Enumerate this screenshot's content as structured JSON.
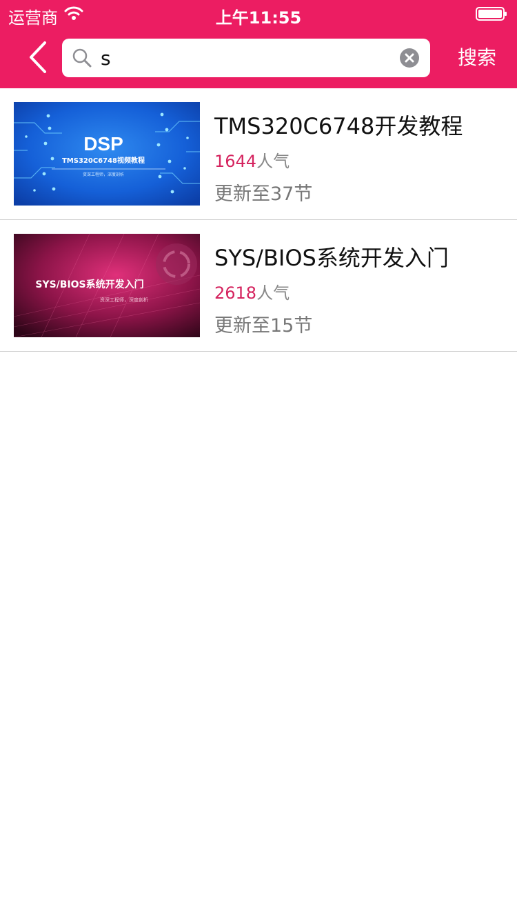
{
  "status_bar": {
    "carrier": "运营商",
    "time": "上午11:55"
  },
  "nav": {
    "search_value": "s",
    "search_button": "搜索"
  },
  "results": [
    {
      "title": "TMS320C6748开发教程",
      "popularity": "1644",
      "popularity_suffix": "人气",
      "update": "更新至37节",
      "thumb": {
        "heading": "DSP",
        "subtitle": "TMS320C6748视频教程",
        "tagline": "资深工程师，深度剖析"
      }
    },
    {
      "title": "SYS/BIOS系统开发入门",
      "popularity": "2618",
      "popularity_suffix": "人气",
      "update": "更新至15节",
      "thumb": {
        "heading": "SYS/BIOS系统开发入门",
        "tagline": "资深工程师，深度剖析"
      }
    }
  ],
  "colors": {
    "brand": "#EC1D62",
    "popularity": "#D5245F"
  }
}
